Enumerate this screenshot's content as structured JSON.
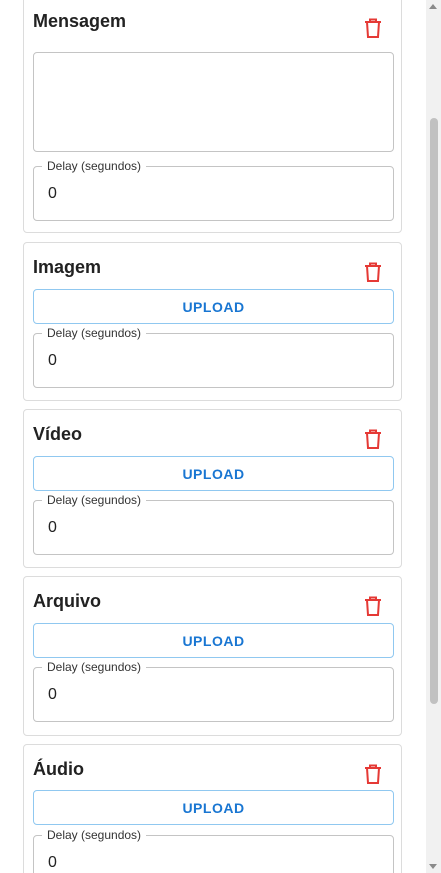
{
  "colors": {
    "accent": "#1976d2",
    "danger": "#e53935",
    "border": "#c4c4c4"
  },
  "cards": [
    {
      "title": "Mensagem",
      "delay_label": "Delay (segundos)",
      "delay_value": "0",
      "trash_icon": "trash-icon"
    },
    {
      "title": "Imagem",
      "upload_label": "UPLOAD",
      "delay_label": "Delay (segundos)",
      "delay_value": "0",
      "trash_icon": "trash-icon"
    },
    {
      "title": "Vídeo",
      "upload_label": "UPLOAD",
      "delay_label": "Delay (segundos)",
      "delay_value": "0",
      "trash_icon": "trash-icon"
    },
    {
      "title": "Arquivo",
      "upload_label": "UPLOAD",
      "delay_label": "Delay (segundos)",
      "delay_value": "0",
      "trash_icon": "trash-icon"
    },
    {
      "title": "Áudio",
      "upload_label": "UPLOAD",
      "delay_label": "Delay (segundos)",
      "delay_value": "0",
      "trash_icon": "trash-icon"
    }
  ]
}
